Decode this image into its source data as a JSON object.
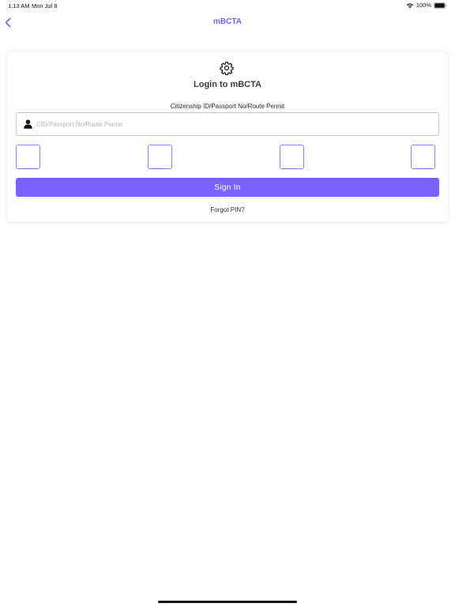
{
  "status_bar": {
    "time": "1:13 AM",
    "date": "Mon Jul 8",
    "battery": "100%",
    "icons": [
      "wifi-icon",
      "battery-icon"
    ]
  },
  "nav": {
    "back_icon": "chevron-left-icon",
    "title": "mBCTA"
  },
  "login": {
    "icon": "gear-icon",
    "title": "Login to mBCTA",
    "id_label": "Citizenship ID/Passport No/Route Permit",
    "id_placeholder": "CID/Passport No/Route Permit",
    "id_value": "",
    "id_icon": "user-icon",
    "pin_boxes": [
      "",
      "",
      "",
      ""
    ],
    "sign_in_label": "Sign In",
    "forgot_label": "Forgot PIN?"
  },
  "colors": {
    "accent": "#7b61ff",
    "pin_border": "#8e7dff",
    "field_border": "#c7c7cc",
    "background": "#ffffff"
  }
}
